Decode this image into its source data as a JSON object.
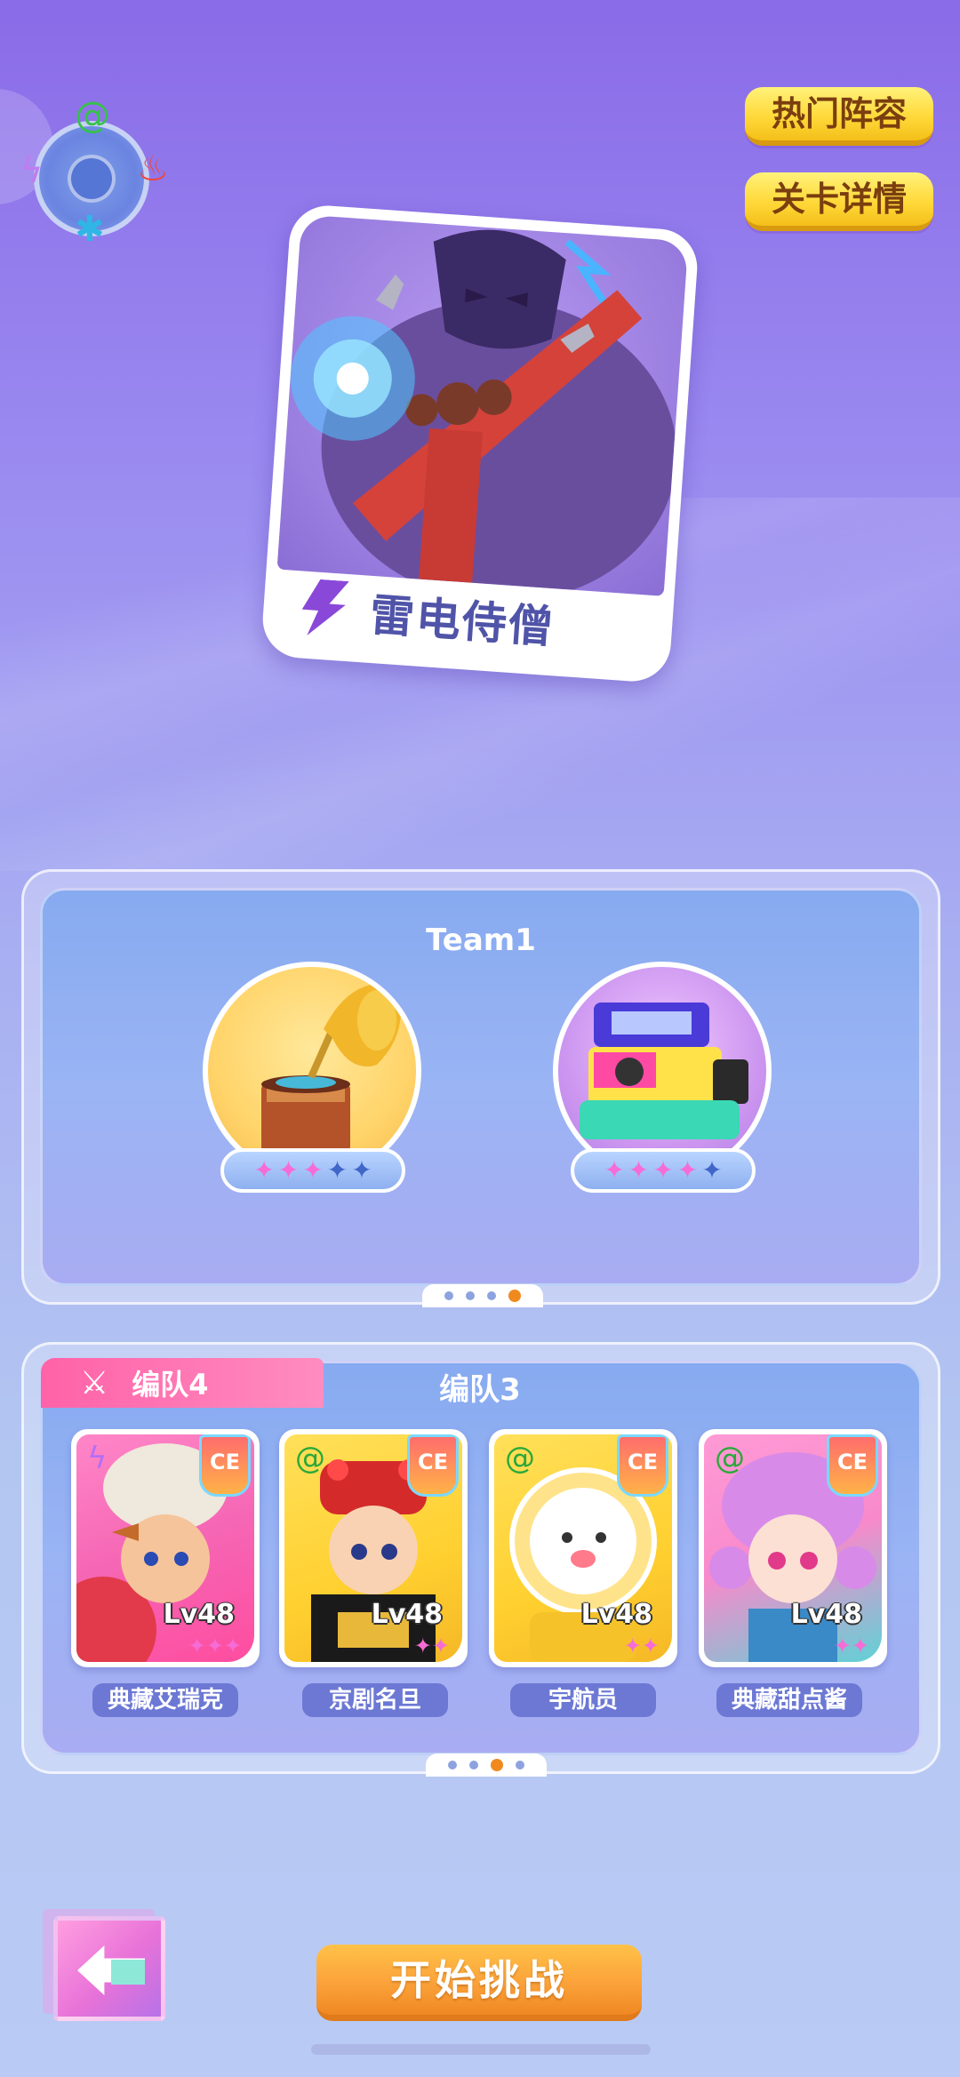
{
  "element_wheel": {
    "icons": [
      "grass-spiral-icon",
      "fire-icon",
      "thunder-icon",
      "ice-snowflake-icon"
    ]
  },
  "top_buttons": {
    "popular_lineup": "热门阵容",
    "stage_details": "关卡详情"
  },
  "boss": {
    "name": "雷电侍僧",
    "element": "thunder"
  },
  "team_panel": {
    "title": "Team1",
    "items": [
      {
        "name": "gramophone",
        "stars_filled": 3,
        "stars_total": 5
      },
      {
        "name": "instant-camera",
        "stars_filled": 4,
        "stars_total": 5
      }
    ],
    "page_dots": 4,
    "active_dot": 4
  },
  "squad_panel": {
    "active_tab": "编队4",
    "other_tab": "编队3",
    "heroes": [
      {
        "name": "典藏艾瑞克",
        "level": "Lv48",
        "element": "thunder",
        "badge": "CE",
        "stars": 3
      },
      {
        "name": "京剧名旦",
        "level": "Lv48",
        "element": "grass",
        "badge": "CE",
        "stars": 2
      },
      {
        "name": "宇航员",
        "level": "Lv48",
        "element": "grass",
        "badge": "CE",
        "stars": 2
      },
      {
        "name": "典藏甜点酱",
        "level": "Lv48",
        "element": "grass",
        "badge": "CE",
        "stars": 2
      }
    ],
    "page_dots": 4,
    "active_dot": 3
  },
  "start_button": "开始挑战",
  "colors": {
    "accent_yellow": "#ffd93a",
    "accent_orange": "#fba23a",
    "tab_pink": "#ff62a8",
    "star_on": "#f56cd6",
    "star_off": "#3f66c8"
  }
}
